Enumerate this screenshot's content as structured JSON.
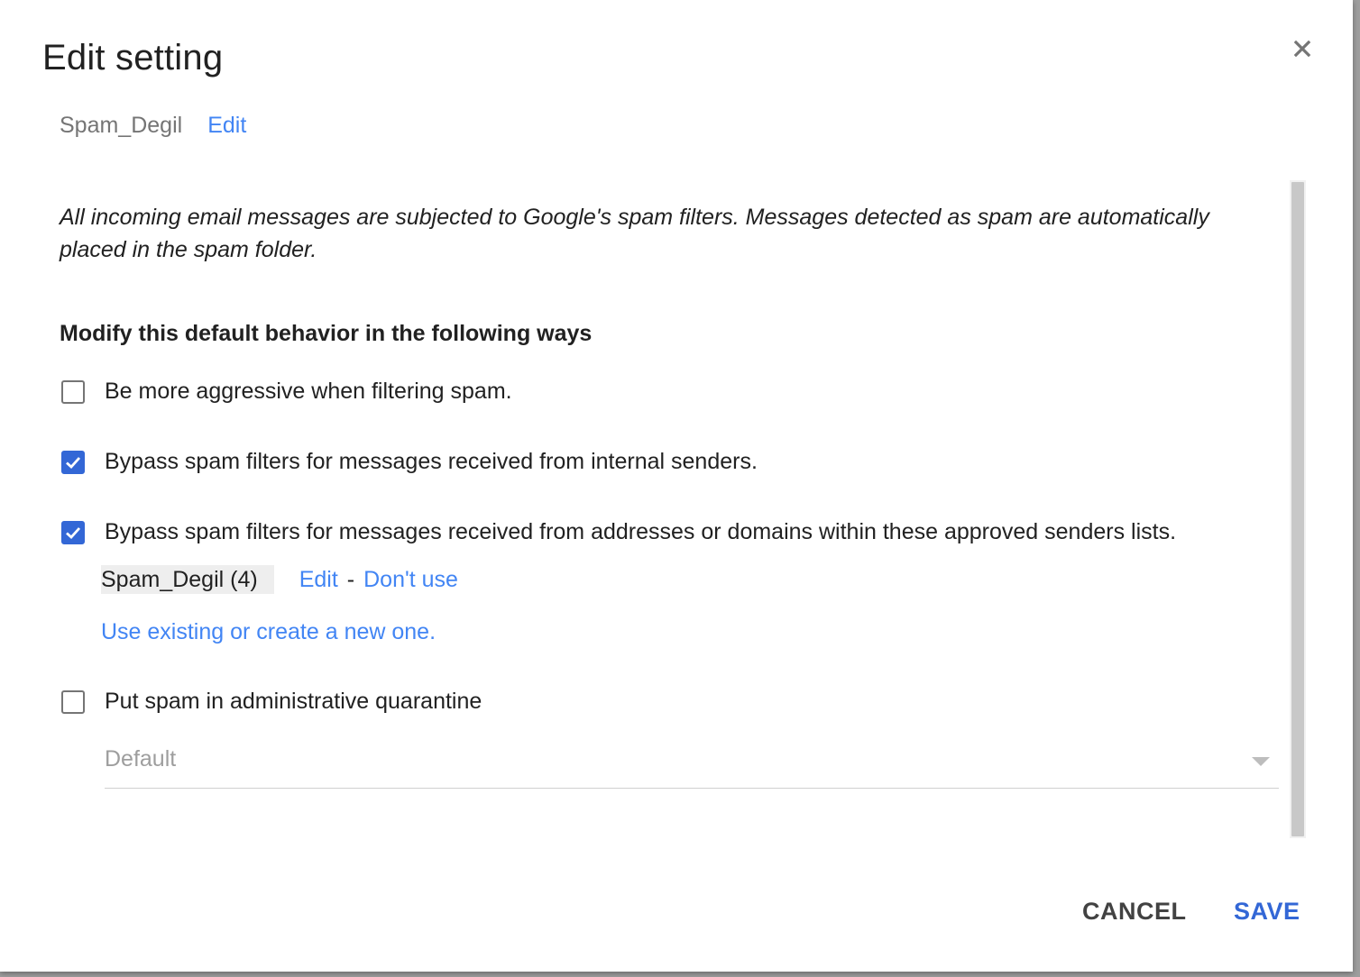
{
  "dialog": {
    "title": "Edit setting",
    "close_icon": "close-icon"
  },
  "setting": {
    "name": "Spam_Degil",
    "edit_label": "Edit"
  },
  "description": "All incoming email messages are subjected to Google's spam filters. Messages detected as spam are automatically placed in the spam folder.",
  "section_heading": "Modify this default behavior in the following ways",
  "options": [
    {
      "label": "Be more aggressive when filtering spam.",
      "checked": false
    },
    {
      "label": "Bypass spam filters for messages received from internal senders.",
      "checked": true
    },
    {
      "label": "Bypass spam filters for messages received from addresses or domains within these approved senders lists.",
      "checked": true
    },
    {
      "label": "Put spam in administrative quarantine",
      "checked": false
    }
  ],
  "approved_list": {
    "name": "Spam_Degil (4)",
    "edit_label": "Edit",
    "separator": "-",
    "dont_use_label": "Don't use",
    "use_existing_label": "Use existing or create a new one."
  },
  "quarantine_select": {
    "value": "Default"
  },
  "actions": {
    "cancel_label": "CANCEL",
    "save_label": "SAVE"
  },
  "colors": {
    "accent": "#3367d6",
    "link": "#4285f4",
    "text": "#212121",
    "muted": "#757575"
  }
}
